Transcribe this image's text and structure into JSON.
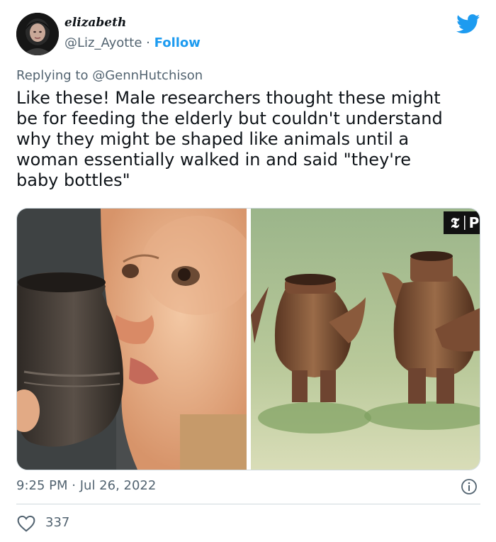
{
  "author": {
    "display_name": "elizabeth",
    "handle": "@Liz_Ayotte",
    "separator": "·",
    "follow_label": "Follow"
  },
  "reply": {
    "prefix": "Replying to",
    "to": "@GennHutchison"
  },
  "tweet": {
    "text": "Like these! Male researchers thought these might\nbe for feeding the elderly but couldn't understand\nwhy they might be shaped like animals until a\nwoman essentially walked in and said \"they're\nbaby bottles\""
  },
  "media": {
    "left_image": "baby drinking from clay vessel",
    "right_image": "animal-shaped clay vessels",
    "watermark": "P"
  },
  "meta": {
    "time": "9:25 PM",
    "separator": "·",
    "date": "Jul 26, 2022"
  },
  "stats": {
    "likes": "337"
  },
  "icons": {
    "bird": "twitter-bird-icon",
    "info": "info-icon",
    "heart": "heart-icon"
  },
  "colors": {
    "accent": "#1d9bf0",
    "secondary_text": "#536471",
    "border": "#cfd9de"
  }
}
